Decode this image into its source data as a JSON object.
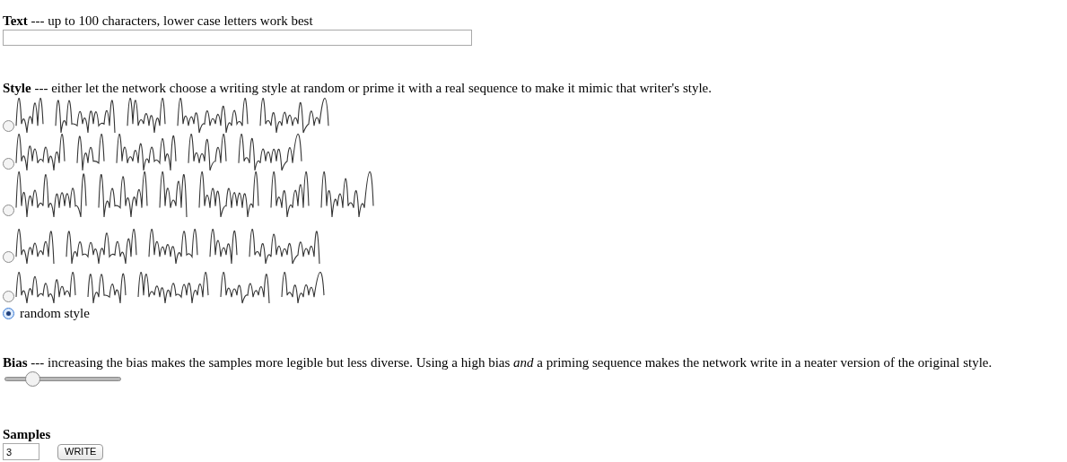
{
  "text_section": {
    "label": "**Text** --- up to 100 characters, lower case letters work best"
  },
  "style_section": {
    "label": "**Style** --- either let the network choose a writing style at random or prime it with a real sequence to make it mimic that writer's style.",
    "options": [
      {
        "kind": "picture",
        "selected": false
      },
      {
        "kind": "picture",
        "selected": false
      },
      {
        "kind": "picture",
        "selected": false
      },
      {
        "kind": "picture",
        "selected": false
      },
      {
        "kind": "picture",
        "selected": false
      },
      {
        "kind": "text",
        "label": "random style",
        "selected": true
      }
    ]
  },
  "bias_section": {
    "label": "**Bias** --- increasing the bias makes the samples more legible but less diverse. Using a high bias *and* a priming sequence makes the network write in a neater version of the original style.",
    "slider": {
      "level": 0.2
    }
  },
  "samples_section": {
    "title": "Samples",
    "input": {
      "value": "3"
    },
    "button": "WRITE"
  }
}
